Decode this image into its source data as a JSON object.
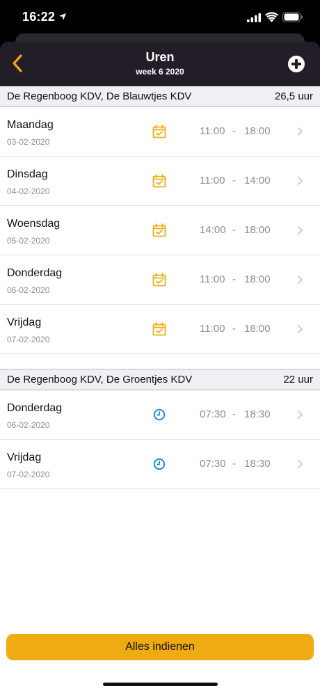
{
  "status_bar": {
    "time": "16:22"
  },
  "header": {
    "title": "Uren",
    "subtitle": "week 6 2020"
  },
  "colors": {
    "accent": "#f0aa12",
    "nav_bg": "#221d27",
    "clock_blue": "#1a8ad8",
    "calendar_yellow": "#e9b018"
  },
  "groups": [
    {
      "name": "De Regenboog KDV, De Blauwtjes KDV",
      "total": "26,5 uur",
      "rows": [
        {
          "day": "Maandag",
          "date": "03-02-2020",
          "icon": "calendar-check-icon",
          "start": "11:00",
          "dash": "-",
          "end": "18:00"
        },
        {
          "day": "Dinsdag",
          "date": "04-02-2020",
          "icon": "calendar-check-icon",
          "start": "11:00",
          "dash": "-",
          "end": "14:00"
        },
        {
          "day": "Woensdag",
          "date": "05-02-2020",
          "icon": "calendar-check-icon",
          "start": "14:00",
          "dash": "-",
          "end": "18:00"
        },
        {
          "day": "Donderdag",
          "date": "06-02-2020",
          "icon": "calendar-check-icon",
          "start": "11:00",
          "dash": "-",
          "end": "18:00"
        },
        {
          "day": "Vrijdag",
          "date": "07-02-2020",
          "icon": "calendar-check-icon",
          "start": "11:00",
          "dash": "-",
          "end": "18:00"
        }
      ]
    },
    {
      "name": "De Regenboog KDV, De Groentjes KDV",
      "total": "22 uur",
      "rows": [
        {
          "day": "Donderdag",
          "date": "06-02-2020",
          "icon": "clock-icon",
          "start": "07:30",
          "dash": "-",
          "end": "18:30"
        },
        {
          "day": "Vrijdag",
          "date": "07-02-2020",
          "icon": "clock-icon",
          "start": "07:30",
          "dash": "-",
          "end": "18:30"
        }
      ]
    }
  ],
  "footer": {
    "submit_label": "Alles indienen"
  }
}
